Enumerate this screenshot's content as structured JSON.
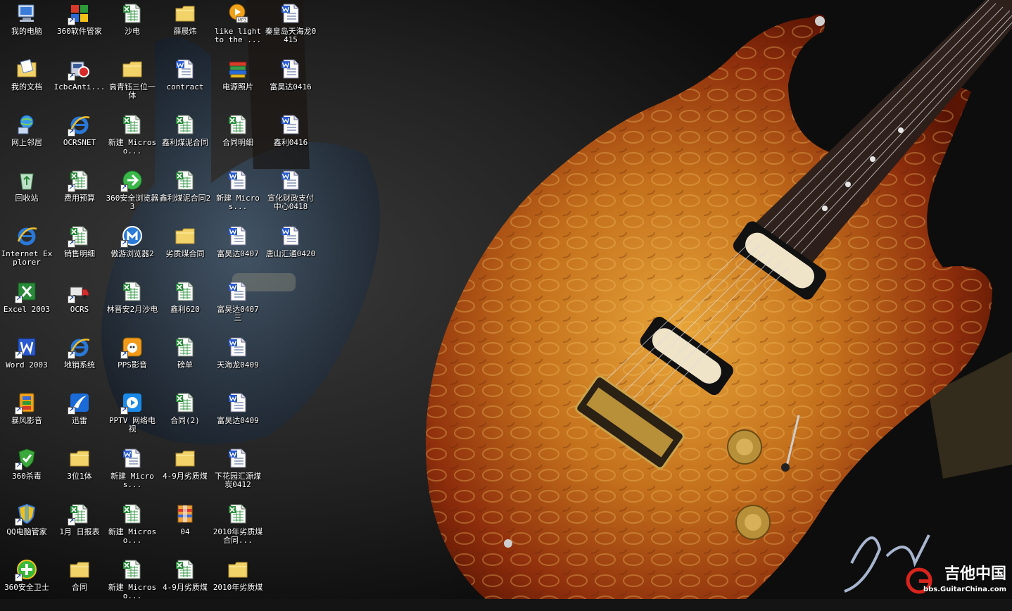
{
  "desktop": {
    "watermark_text": "吉他中国",
    "watermark_url": "bbs.GuitarChina.com",
    "icons": [
      {
        "label": "我的电脑",
        "type": "computer",
        "shortcut": false
      },
      {
        "label": "我的文档",
        "type": "mydocs",
        "shortcut": false
      },
      {
        "label": "网上邻居",
        "type": "network",
        "shortcut": false
      },
      {
        "label": "回收站",
        "type": "recycle",
        "shortcut": false
      },
      {
        "label": "Internet Explorer",
        "type": "ie",
        "shortcut": false
      },
      {
        "label": "Excel 2003",
        "type": "excel-app",
        "shortcut": true
      },
      {
        "label": "Word 2003",
        "type": "word-app",
        "shortcut": true
      },
      {
        "label": "暴风影音",
        "type": "storm",
        "shortcut": true
      },
      {
        "label": "360杀毒",
        "type": "shield360",
        "shortcut": true
      },
      {
        "label": "QQ电脑管家",
        "type": "qqguard",
        "shortcut": true
      },
      {
        "label": "360安全卫士",
        "type": "guard360",
        "shortcut": true
      },
      {
        "label": "360软件管家",
        "type": "soft360",
        "shortcut": true
      },
      {
        "label": "IcbcAnti...",
        "type": "icbc",
        "shortcut": true
      },
      {
        "label": "OCRSNET",
        "type": "ie",
        "shortcut": true
      },
      {
        "label": "费用预算",
        "type": "excel",
        "shortcut": true
      },
      {
        "label": "销售明细",
        "type": "excel",
        "shortcut": true
      },
      {
        "label": "OCRS",
        "type": "truck",
        "shortcut": true
      },
      {
        "label": "地销系统",
        "type": "ie",
        "shortcut": true
      },
      {
        "label": "迅雷",
        "type": "thunder",
        "shortcut": true
      },
      {
        "label": "3位1体",
        "type": "folder",
        "shortcut": false
      },
      {
        "label": "1月 日报表",
        "type": "excel",
        "shortcut": true
      },
      {
        "label": "合同",
        "type": "folder",
        "shortcut": false
      },
      {
        "label": "沙电",
        "type": "excel",
        "shortcut": false
      },
      {
        "label": "高青钰三位一体",
        "type": "folder",
        "shortcut": false
      },
      {
        "label": "新建 Microso...",
        "type": "excel",
        "shortcut": false
      },
      {
        "label": "360安全浏览器 3",
        "type": "browser360",
        "shortcut": true
      },
      {
        "label": "傲游浏览器2",
        "type": "maxthon",
        "shortcut": true
      },
      {
        "label": "林晋安2月沙电",
        "type": "excel",
        "shortcut": false
      },
      {
        "label": "PPS影音",
        "type": "pps",
        "shortcut": true
      },
      {
        "label": "PPTV 网络电视",
        "type": "pptv",
        "shortcut": true
      },
      {
        "label": "新建 Micros...",
        "type": "word",
        "shortcut": false
      },
      {
        "label": "新建 Microso...",
        "type": "excel",
        "shortcut": false
      },
      {
        "label": "新建 Microso...",
        "type": "excel",
        "shortcut": false
      },
      {
        "label": "薛晨炜",
        "type": "folder",
        "shortcut": false
      },
      {
        "label": "contract",
        "type": "word",
        "shortcut": false
      },
      {
        "label": "鑫利煤泥合同",
        "type": "excel",
        "shortcut": false
      },
      {
        "label": "鑫利煤泥合同2",
        "type": "excel",
        "shortcut": false
      },
      {
        "label": "劣质煤合同",
        "type": "folder",
        "shortcut": false
      },
      {
        "label": "鑫利620",
        "type": "excel",
        "shortcut": false
      },
      {
        "label": "磅单",
        "type": "excel",
        "shortcut": false
      },
      {
        "label": "合同(2)",
        "type": "excel",
        "shortcut": false
      },
      {
        "label": "4-9月劣质煤",
        "type": "folder",
        "shortcut": false
      },
      {
        "label": "04",
        "type": "winrar",
        "shortcut": false
      },
      {
        "label": "4-9月劣质煤",
        "type": "excel",
        "shortcut": false
      },
      {
        "label": "like light to the ...",
        "type": "mp3",
        "shortcut": false
      },
      {
        "label": "电源照片",
        "type": "books",
        "shortcut": false
      },
      {
        "label": "合同明细",
        "type": "excel",
        "shortcut": false
      },
      {
        "label": "新建 Micros...",
        "type": "word",
        "shortcut": false
      },
      {
        "label": "富昊达0407",
        "type": "word",
        "shortcut": false
      },
      {
        "label": "富昊达0407 三",
        "type": "word",
        "shortcut": false
      },
      {
        "label": "天海龙0409",
        "type": "word",
        "shortcut": false
      },
      {
        "label": "富昊达0409",
        "type": "word",
        "shortcut": false
      },
      {
        "label": "下花园汇源煤炭0412",
        "type": "word",
        "shortcut": false
      },
      {
        "label": "2010年劣质煤合同...",
        "type": "excel",
        "shortcut": false
      },
      {
        "label": "2010年劣质煤",
        "type": "folder",
        "shortcut": false
      },
      {
        "label": "秦皇岛天海龙0415",
        "type": "word",
        "shortcut": false
      },
      {
        "label": "富昊达0416",
        "type": "word",
        "shortcut": false
      },
      {
        "label": "鑫利0416",
        "type": "word",
        "shortcut": false
      },
      {
        "label": "宣化财政支付中心0418",
        "type": "word",
        "shortcut": false
      },
      {
        "label": "唐山汇通0420",
        "type": "word",
        "shortcut": false
      }
    ]
  }
}
